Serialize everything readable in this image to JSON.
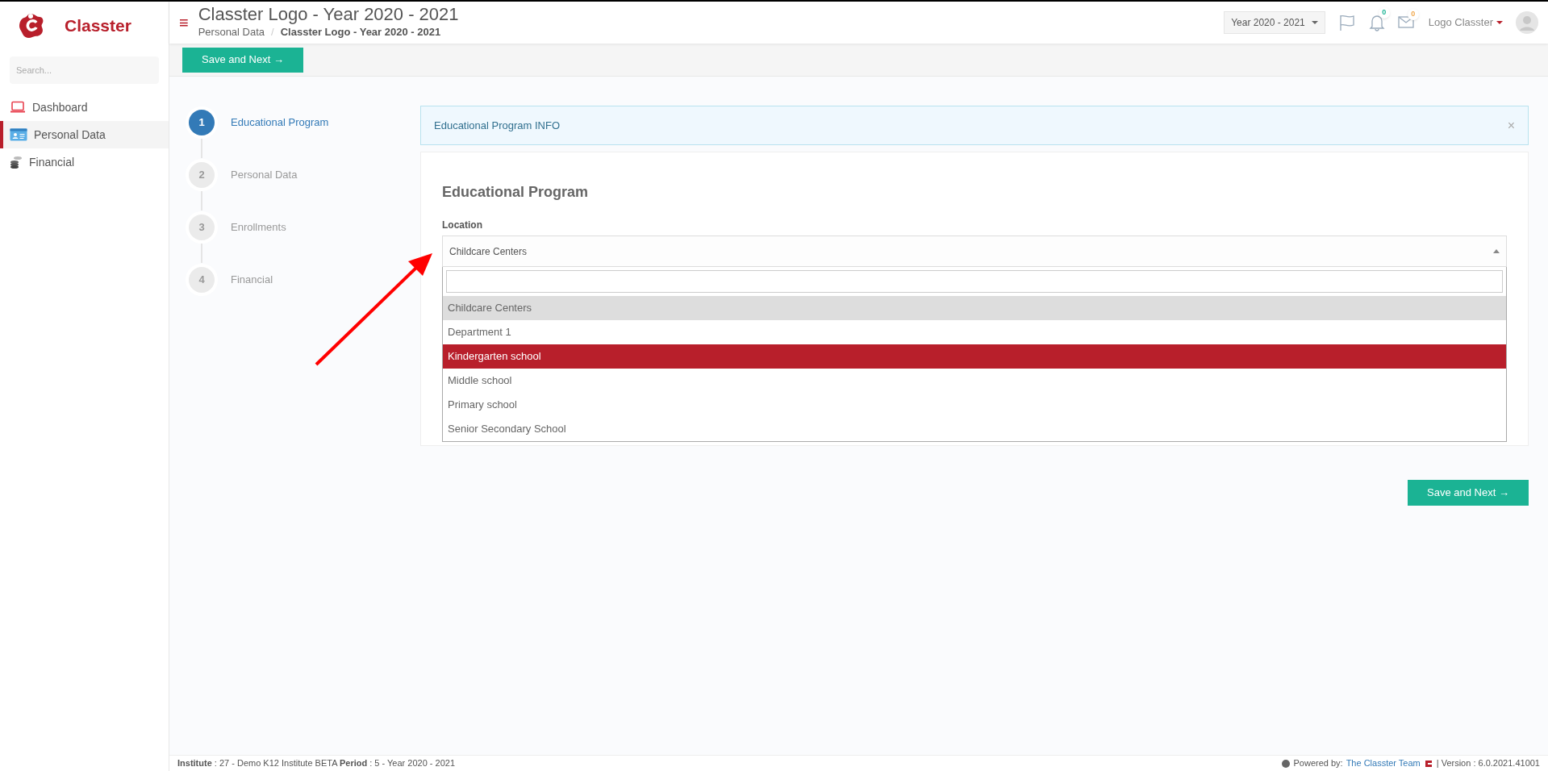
{
  "sidebar": {
    "brand": "Classter",
    "search": {
      "placeholder": "Search..."
    },
    "items": [
      {
        "label": "Dashboard",
        "kind": "laptop",
        "selected": false
      },
      {
        "label": "Personal Data",
        "kind": "card",
        "selected": true
      },
      {
        "label": "Financial",
        "kind": "coins",
        "selected": false
      }
    ]
  },
  "header": {
    "menu_icon": "≡",
    "separator": "/",
    "title": "Classter Logo - Year 2020 - 2021",
    "breadcrumb": [
      "Personal Data",
      "Classter Logo - Year 2020 - 2021"
    ],
    "year_select": "Year 2020 - 2021",
    "notifications": "0",
    "messages": "0",
    "user": "Logo Classter"
  },
  "toolbar": {
    "button": "Save and Next →"
  },
  "steps": [
    {
      "number": "1",
      "label": "Educational Program",
      "selected": true
    },
    {
      "number": "2",
      "label": "Personal Data",
      "selected": false
    },
    {
      "number": "3",
      "label": "Enrollments",
      "selected": false
    },
    {
      "number": "4",
      "label": "Financial",
      "selected": false
    }
  ],
  "info_alert": {
    "text": "Educational Program INFO",
    "close": "×"
  },
  "form": {
    "title": "Educational Program",
    "field_label": "Location",
    "value": "Childcare Centers",
    "expanded": true,
    "options": [
      {
        "label": "Childcare Centers",
        "selected": true,
        "highlighted": false
      },
      {
        "label": "Department 1",
        "selected": false,
        "highlighted": false
      },
      {
        "label": "Kindergarten school",
        "selected": false,
        "highlighted": true
      },
      {
        "label": "Middle school",
        "selected": false,
        "highlighted": false
      },
      {
        "label": "Primary school",
        "selected": false,
        "highlighted": false
      },
      {
        "label": "Senior Secondary School",
        "selected": false,
        "highlighted": false
      }
    ]
  },
  "bottom_button": "Save and Next →",
  "footer": {
    "info": "**Institute** : 27 - Demo K12 Institute BETA **Period** : 5 - Year 2020 - 2021",
    "powered_by": "Powered by:",
    "team": "The Classter Team",
    "version": "| Version : 6.0.2021.41001"
  }
}
